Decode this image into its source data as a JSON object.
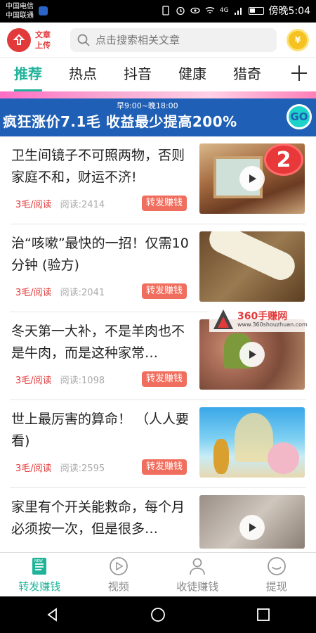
{
  "status": {
    "carrier1": "中国电信",
    "carrier2": "中国联通",
    "net": "4G",
    "time": "傍晚5:04"
  },
  "header": {
    "logo_line1": "文章",
    "logo_line2": "上传",
    "search_placeholder": "点击搜索相关文章",
    "coin_symbol": "¥"
  },
  "tabs": [
    "推荐",
    "热点",
    "抖音",
    "健康",
    "猎奇"
  ],
  "banner": {
    "time": "早9:00~晚18:00",
    "text": "疯狂涨价7.1毛  收益最少提高200%",
    "go": "GO"
  },
  "articles": [
    {
      "title": "卫生间镜子不可照两物，否则家庭不和，财运不济!",
      "price": "3毛/阅读",
      "reads": "阅读:2414",
      "share": "转发赚钱",
      "badge": "2"
    },
    {
      "title": "治“咳嗽”最快的一招！仅需10分钟 (验方)",
      "price": "3毛/阅读",
      "reads": "阅读:2041",
      "share": "转发赚钱"
    },
    {
      "title": "冬天第一大补，不是羊肉也不是牛肉，而是这种家常…",
      "price": "3毛/阅读",
      "reads": "阅读:1098",
      "share": "转发赚钱"
    },
    {
      "title": "世上最厉害的算命！ （人人要看)",
      "price": "3毛/阅读",
      "reads": "阅读:2595",
      "share": "转发赚钱"
    },
    {
      "title": "家里有个开关能救命，每个月必须按一次，但是很多…",
      "price": "",
      "reads": "",
      "share": ""
    }
  ],
  "watermark": {
    "text": "360手赚网",
    "url": "www.360shouzhuan.com"
  },
  "bottom_nav": [
    {
      "label": "转发赚钱",
      "icon": "news-icon"
    },
    {
      "label": "视频",
      "icon": "play-circle-icon"
    },
    {
      "label": "收徒赚钱",
      "icon": "users-icon"
    },
    {
      "label": "提现",
      "icon": "smile-icon"
    }
  ],
  "colors": {
    "accent": "#20b39a",
    "red": "#e23a3a",
    "share": "#f06e5e"
  }
}
